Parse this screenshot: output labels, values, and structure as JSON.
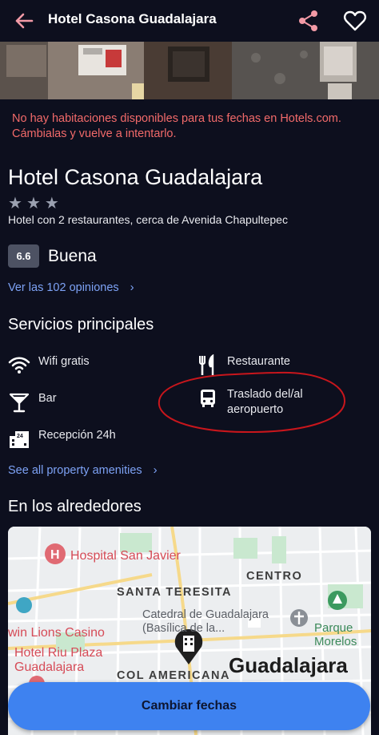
{
  "header": {
    "title": "Hotel Casona Guadalajara",
    "back_icon": "arrow-left-icon",
    "share_icon": "share-icon",
    "favorite_icon": "heart-outline-icon"
  },
  "alert": {
    "message": "No hay habitaciones disponibles para tus fechas en Hotels.com. Cámbialas y vuelve a intentarlo.",
    "color": "#f26a6a"
  },
  "hotel": {
    "name": "Hotel Casona Guadalajara",
    "stars": 3,
    "description": "Hotel con 2 restaurantes, cerca de Avenida Chapultepec",
    "rating_score": "6.6",
    "rating_label": "Buena",
    "reviews_link": "Ver las 102 opiniones"
  },
  "amenities": {
    "section_title": "Servicios principales",
    "items": [
      {
        "label": "Wifi gratis",
        "icon": "wifi-icon"
      },
      {
        "label": "Restaurante",
        "icon": "restaurant-icon"
      },
      {
        "label": "Bar",
        "icon": "cocktail-icon"
      },
      {
        "label": "Traslado del/al aeropuerto",
        "icon": "bus-icon"
      },
      {
        "label": "Recepción 24h",
        "icon": "reception-24h-icon"
      }
    ],
    "see_all_link": "See all property amenities"
  },
  "nearby": {
    "section_title": "En los alrededores",
    "map_labels": {
      "hospital": "Hospital San Javier",
      "centro": "CENTRO",
      "santa_teresita": "SANTA TERESITA",
      "catedral_line1": "Catedral de Guadalajara",
      "catedral_line2": "(Basílica de la...",
      "parque_line1": "Parque",
      "parque_line2": "Morelos",
      "casino": "win Lions Casino",
      "riu_line1": "Hotel Riu Plaza",
      "riu_line2": "Guadalajara",
      "americana": "COL AMERICANA",
      "city": "Guadalajara"
    }
  },
  "cta": {
    "label": "Cambiar fechas",
    "color": "#3e82f0"
  },
  "colors": {
    "background": "#0d0f1e",
    "link": "#7da2f5",
    "annotation_circle": "#c8161c"
  }
}
